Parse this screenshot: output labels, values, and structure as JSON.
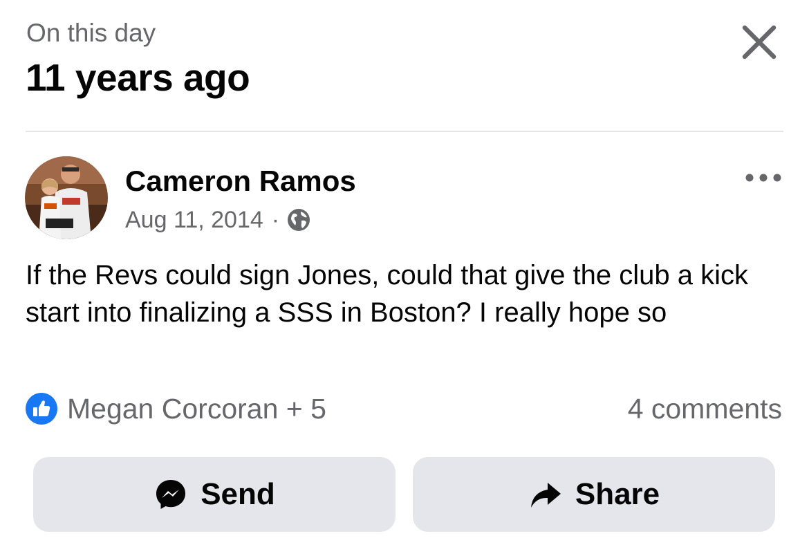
{
  "header": {
    "overline": "On this day",
    "title": "11 years ago",
    "close_icon": "close-icon"
  },
  "post": {
    "author": "Cameron Ramos",
    "date": "Aug 11, 2014",
    "separator": "·",
    "privacy_icon": "globe-icon",
    "more_icon": "more-options-icon",
    "text": "If the Revs could sign Jones, could that give the club a kick start into finalizing a SSS in Boston? I really hope so",
    "reactions": {
      "icon": "like-icon",
      "summary": "Megan Corcoran + 5"
    },
    "comments": "4 comments"
  },
  "actions": {
    "send": {
      "label": "Send",
      "icon": "messenger-icon"
    },
    "share": {
      "label": "Share",
      "icon": "share-arrow-icon"
    }
  },
  "colors": {
    "secondary_text": "#65676b",
    "primary_text": "#050505",
    "like_blue": "#1877f2",
    "button_bg": "#e4e6eb",
    "divider": "#e4e6eb"
  }
}
